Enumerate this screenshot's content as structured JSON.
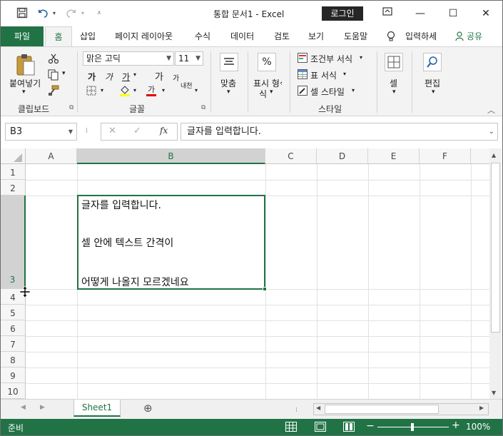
{
  "titlebar": {
    "title": "통합 문서1  -  Excel",
    "login_label": "로그인",
    "save_icon": "save-icon",
    "undo_icon": "undo-icon",
    "redo_icon": "redo-icon",
    "customize_icon": "customize-icon",
    "ribbon_display_icon": "ribbon-display-icon",
    "minimize_glyph": "—",
    "maximize_glyph": "☐",
    "close_glyph": "✕"
  },
  "tabs": {
    "file": "파일",
    "items": [
      "홈",
      "삽입",
      "페이지 레이아웃",
      "수식",
      "데이터",
      "검토",
      "보기",
      "도움말"
    ],
    "tell_me": "입력하세",
    "share": "공유"
  },
  "ribbon": {
    "clipboard": {
      "paste": "붙여넣기",
      "label": "클립보드"
    },
    "font": {
      "name": "맑은 고딕",
      "size": "11",
      "label": "글꼴",
      "bold": "가",
      "italic": "가",
      "underline": "가",
      "grow": "가",
      "shrink": "가",
      "phonetic": "내천"
    },
    "align": {
      "label": "맞춤"
    },
    "number": {
      "label": "표시 형식",
      "label2": "식",
      "percent": "%"
    },
    "styles": {
      "conditional": "조건부 서식",
      "table": "표 서식",
      "cell_style": "셀 스타일",
      "label": "스타일"
    },
    "cells": {
      "label": "셀"
    },
    "editing": {
      "label": "편집"
    }
  },
  "formula_bar": {
    "name_box": "B3",
    "fx": "fx",
    "content": "글자를 입력합니다."
  },
  "grid": {
    "columns": [
      "A",
      "B",
      "C",
      "D",
      "E",
      "F"
    ],
    "rows": [
      "1",
      "2",
      "3",
      "4",
      "5",
      "6",
      "7",
      "8",
      "9",
      "10"
    ],
    "selected_cell": "B3",
    "cell_b3_lines": [
      "글자를 입력합니다.",
      "셀 안에 텍스트 간격이",
      "어떻게 나올지 모르겠네요"
    ]
  },
  "sheets": {
    "tabs": [
      "Sheet1"
    ],
    "add_glyph": "⊕"
  },
  "status": {
    "ready": "준비",
    "zoom": "100%"
  },
  "colors": {
    "accent": "#217346"
  }
}
